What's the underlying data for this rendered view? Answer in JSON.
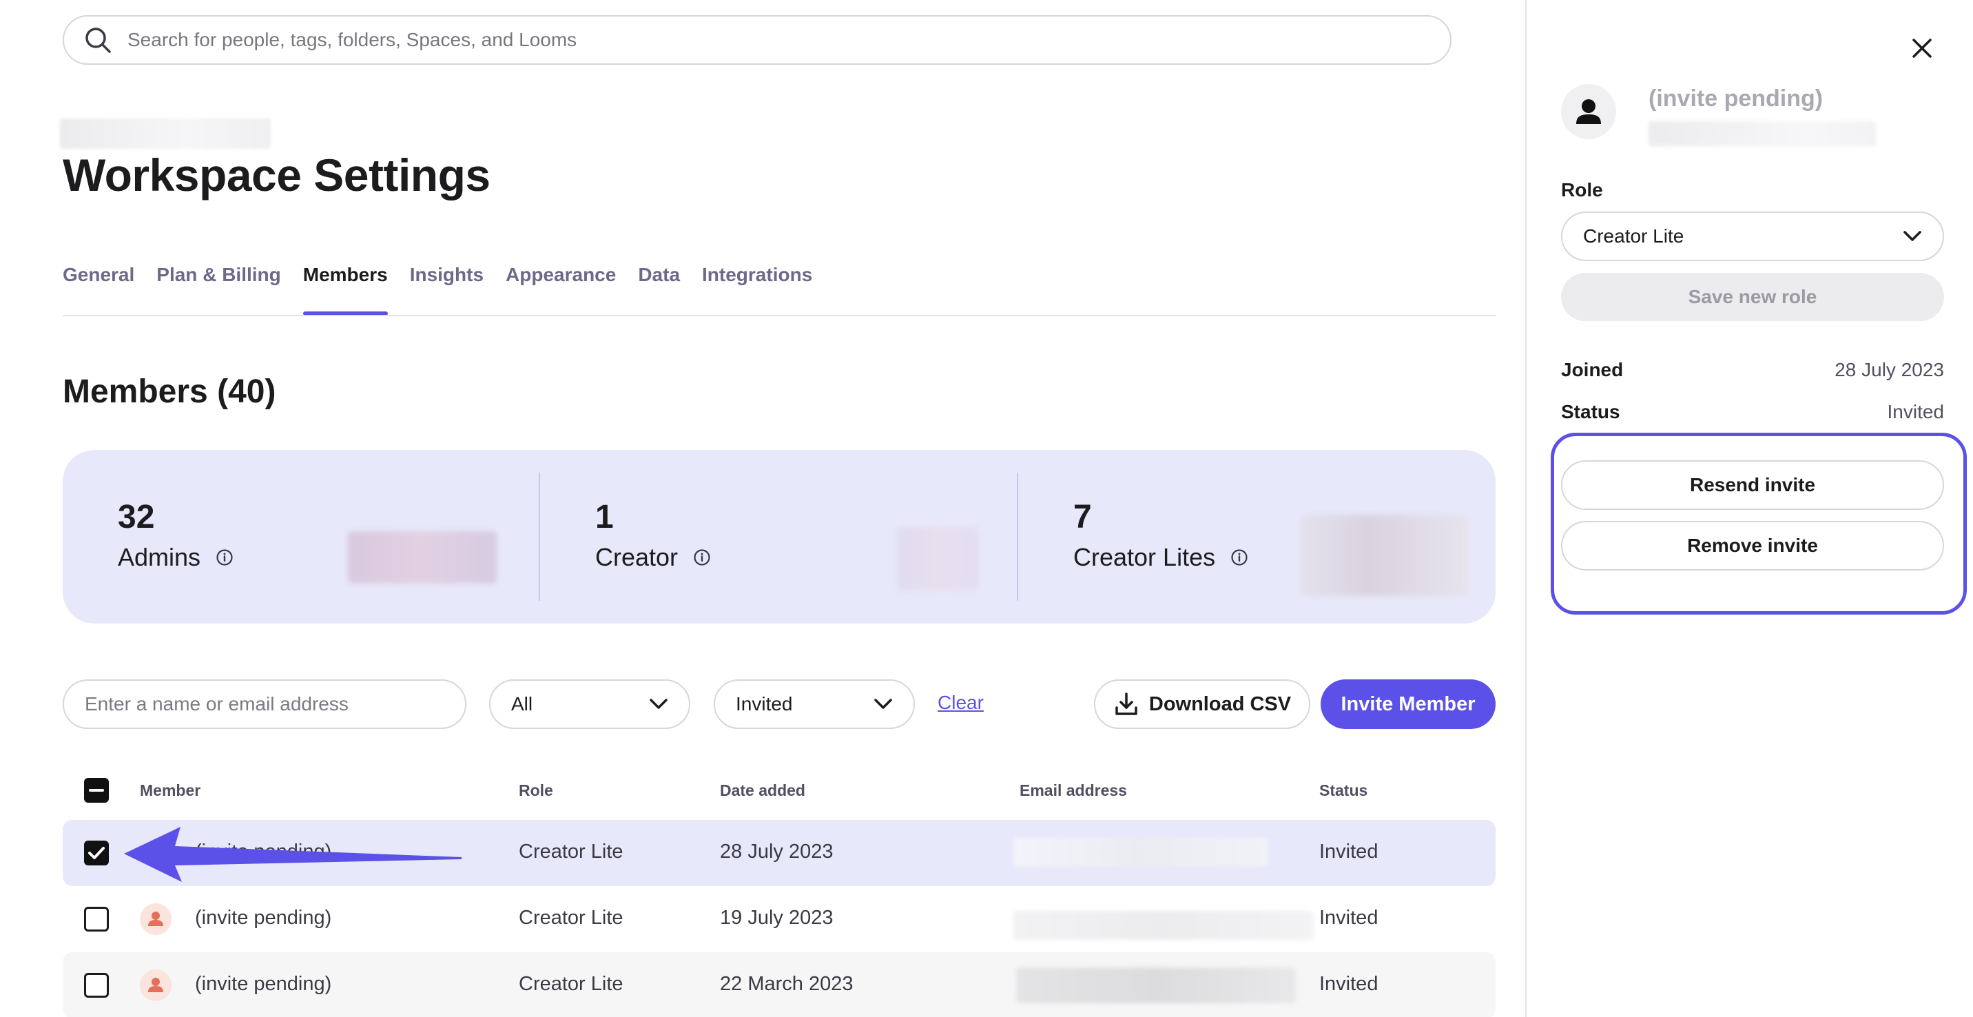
{
  "search": {
    "placeholder": "Search for people, tags, folders, Spaces, and Looms"
  },
  "page": {
    "title": "Workspace Settings"
  },
  "tabs": [
    {
      "label": "General",
      "active": false
    },
    {
      "label": "Plan & Billing",
      "active": false
    },
    {
      "label": "Members",
      "active": true
    },
    {
      "label": "Insights",
      "active": false
    },
    {
      "label": "Appearance",
      "active": false
    },
    {
      "label": "Data",
      "active": false
    },
    {
      "label": "Integrations",
      "active": false
    }
  ],
  "members": {
    "title": "Members (40)",
    "stats": [
      {
        "count": "32",
        "label": "Admins",
        "icon": "info-icon"
      },
      {
        "count": "1",
        "label": "Creator",
        "icon": "info-icon"
      },
      {
        "count": "7",
        "label": "Creator Lites",
        "icon": "info-icon"
      }
    ]
  },
  "filters": {
    "search_placeholder": "Enter a name or email address",
    "role_filter": "All",
    "status_filter": "Invited",
    "clear": "Clear",
    "download_csv": "Download CSV",
    "invite_member": "Invite Member"
  },
  "table": {
    "headers": {
      "member": "Member",
      "role": "Role",
      "date": "Date added",
      "email": "Email address",
      "status": "Status"
    },
    "rows": [
      {
        "member": "(invite pending)",
        "role": "Creator Lite",
        "date": "28 July 2023",
        "status": "Invited",
        "checked": true
      },
      {
        "member": "(invite pending)",
        "role": "Creator Lite",
        "date": "19 July 2023",
        "status": "Invited",
        "checked": false
      },
      {
        "member": "(invite pending)",
        "role": "Creator Lite",
        "date": "22 March 2023",
        "status": "Invited",
        "checked": false
      }
    ]
  },
  "panel": {
    "name": "(invite pending)",
    "role_label": "Role",
    "role_value": "Creator Lite",
    "save_role": "Save new role",
    "joined_label": "Joined",
    "joined_value": "28 July 2023",
    "status_label": "Status",
    "status_value": "Invited",
    "resend_invite": "Resend invite",
    "remove_invite": "Remove invite"
  },
  "colors": {
    "accent": "#5b51e8",
    "stats_bg": "#e8e8fb",
    "avatar_bg": "#fbe3de",
    "avatar_icon": "#e5705a"
  }
}
